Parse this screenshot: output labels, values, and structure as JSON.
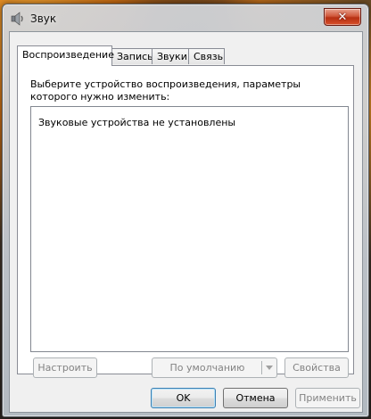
{
  "window": {
    "title": "Звук",
    "close_label": "✕"
  },
  "tabs": [
    {
      "label": "Воспроизведение",
      "active": true
    },
    {
      "label": "Запись",
      "active": false
    },
    {
      "label": "Звуки",
      "active": false
    },
    {
      "label": "Связь",
      "active": false
    }
  ],
  "playback": {
    "instruction": "Выберите устройство воспроизведения, параметры которого нужно изменить:",
    "empty_message": "Звуковые устройства не установлены",
    "configure_label": "Настроить",
    "set_default_label": "По умолчанию",
    "properties_label": "Свойства"
  },
  "footer": {
    "ok_label": "OK",
    "cancel_label": "Отмена",
    "apply_label": "Применить"
  },
  "colors": {
    "accent": "#3c7fb1",
    "close_button": "#c4401f"
  }
}
